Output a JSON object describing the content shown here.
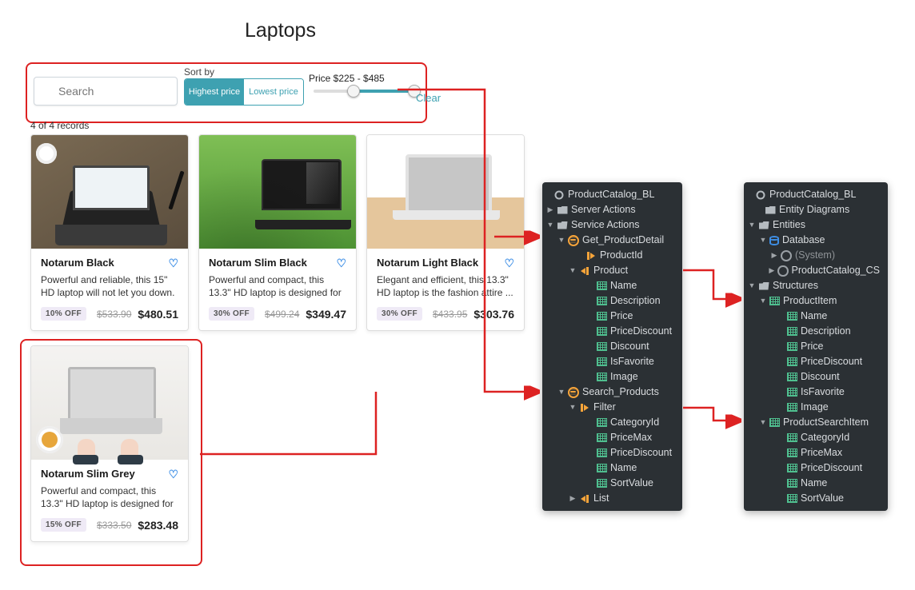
{
  "title": "Laptops",
  "filter": {
    "search_placeholder": "Search",
    "sortby_label": "Sort by",
    "sort_high": "Highest price",
    "sort_low": "Lowest price",
    "price_label": "Price $225 - $485",
    "clear": "Clear"
  },
  "records_text": "4 of 4 records",
  "products": [
    {
      "name": "Notarum Black",
      "desc": "Powerful and reliable, this 15\" HD laptop will not let you down. ...",
      "badge": "10% OFF",
      "old_price": "$533.90",
      "price": "$480.51"
    },
    {
      "name": "Notarum Slim Black",
      "desc": "Powerful and compact, this 13.3\" HD laptop is designed for ...",
      "badge": "30% OFF",
      "old_price": "$499.24",
      "price": "$349.47"
    },
    {
      "name": "Notarum Light Black",
      "desc": "Elegant and efficient, this 13.3\" HD laptop is the fashion attire ...",
      "badge": "30% OFF",
      "old_price": "$433.95",
      "price": "$303.76"
    },
    {
      "name": "Notarum Slim Grey",
      "desc": "Powerful and compact, this 13.3\" HD laptop is designed for ...",
      "badge": "15% OFF",
      "old_price": "$333.50",
      "price": "$283.48"
    }
  ],
  "panel1": {
    "title": "ProductCatalog_BL",
    "server_actions": "Server Actions",
    "service_actions": "Service Actions",
    "get_detail": "Get_ProductDetail",
    "productid": "ProductId",
    "product": "Product",
    "fields": [
      "Name",
      "Description",
      "Price",
      "PriceDiscount",
      "Discount",
      "IsFavorite",
      "Image"
    ],
    "search_products": "Search_Products",
    "filter": "Filter",
    "filter_fields": [
      "CategoryId",
      "PriceMax",
      "PriceDiscount",
      "Name",
      "SortValue"
    ],
    "list": "List"
  },
  "panel2": {
    "title": "ProductCatalog_BL",
    "entity_diagrams": "Entity Diagrams",
    "entities": "Entities",
    "database": "Database",
    "system": "(System)",
    "catalog_cs": "ProductCatalog_CS",
    "structures": "Structures",
    "productitem": "ProductItem",
    "pi_fields": [
      "Name",
      "Description",
      "Price",
      "PriceDiscount",
      "Discount",
      "IsFavorite",
      "Image"
    ],
    "psi": "ProductSearchItem",
    "psi_fields": [
      "CategoryId",
      "PriceMax",
      "PriceDiscount",
      "Name",
      "SortValue"
    ]
  }
}
